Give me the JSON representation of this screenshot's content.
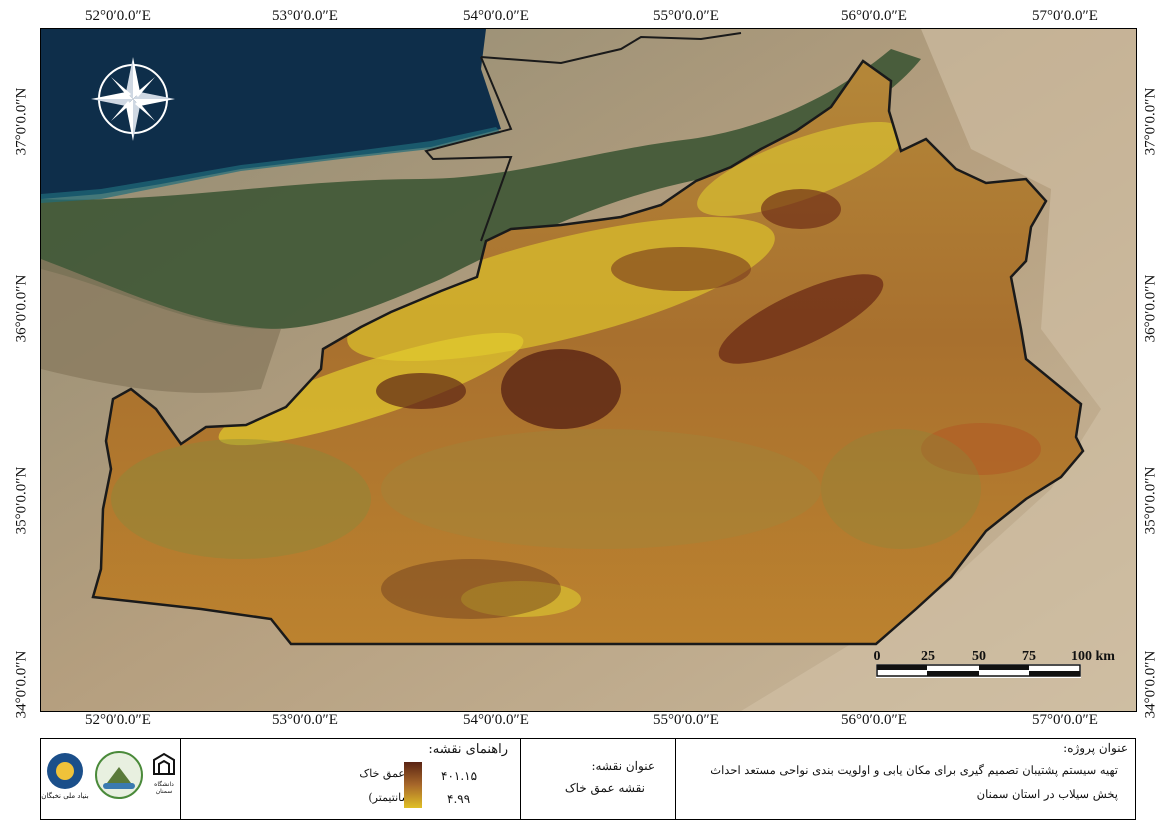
{
  "map": {
    "top_longitude_labels": [
      "52°0′0.0″E",
      "53°0′0.0″E",
      "54°0′0.0″E",
      "55°0′0.0″E",
      "56°0′0.0″E",
      "57°0′0.0″E"
    ],
    "bottom_longitude_labels": [
      "52°0′0.0″E",
      "53°0′0.0″E",
      "54°0′0.0″E",
      "55°0′0.0″E",
      "56°0′0.0″E",
      "57°0′0.0″E"
    ],
    "left_latitude_labels": [
      "37°0′0.0″N",
      "36°0′0.0″N",
      "35°0′0.0″N",
      "34°0′0.0″N"
    ],
    "right_latitude_labels": [
      "37°0′0.0″N",
      "36°0′0.0″N",
      "35°0′0.0″N",
      "34°0′0.0″N"
    ],
    "scale_bar": {
      "ticks": [
        "0",
        "25",
        "50",
        "75",
        "100 km"
      ]
    },
    "north_arrow_icon": "compass-rose-icon",
    "colors": {
      "sea": "#0e2e4a",
      "boundary": "#1a1a1a",
      "soil_high": "#5a2414",
      "soil_low": "#e0c026"
    }
  },
  "footer": {
    "project_title_label": "عنوان پروژه:",
    "project_title_line1": "تهیه سیستم پشتیبان تصمیم گیری برای مکان یابی و اولویت بندی نواحی مستعد احداث",
    "project_title_line2": "پخش سیلاب در استان سمنان",
    "map_title_label": "عنوان نقشه:",
    "map_title": "نقشه عمق خاک",
    "legend_label": "راهنمای نقشه:",
    "legend_layer": "عمق خاک",
    "legend_unit": "(سانتیمتر)",
    "legend_max": "۴۰۱.۱۵",
    "legend_min": "۴.۹۹",
    "logos": {
      "semnan_university": {
        "icon": "semnan-university-logo",
        "caption": "دانشگاه سمنان"
      },
      "watershed": {
        "icon": "watershed-logo"
      },
      "elites": {
        "icon": "elites-foundation-logo",
        "caption": "بنیاد ملی نخبگان"
      }
    }
  }
}
